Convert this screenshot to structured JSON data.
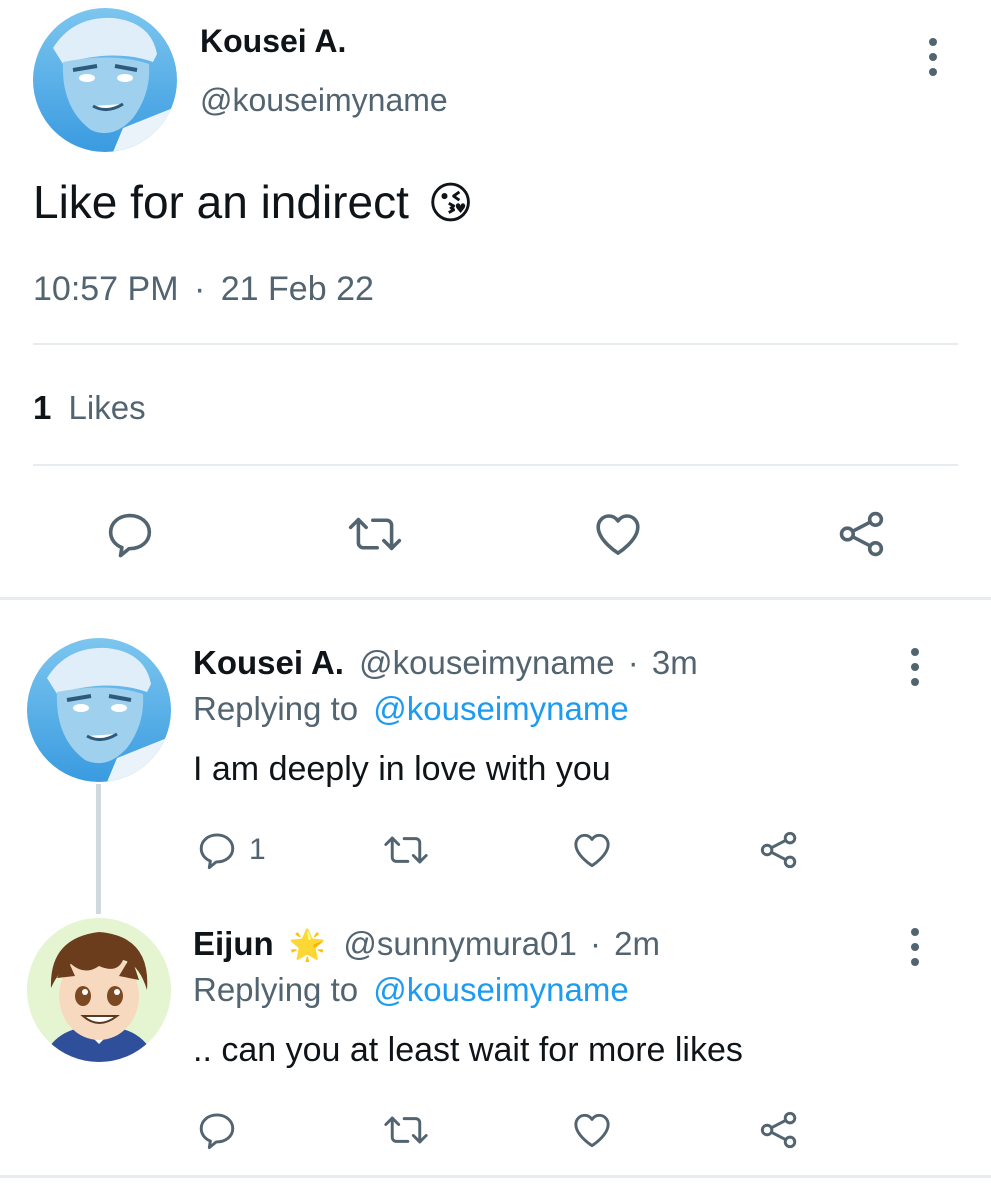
{
  "main_tweet": {
    "author_name": "Kousei A.",
    "author_handle": "@kouseimyname",
    "text": "Like for an indirect",
    "emoji": "😘",
    "time": "10:57 PM",
    "separator": "·",
    "date": "21 Feb 22",
    "likes_count": "1",
    "likes_label": "Likes",
    "avatar_icon": "avatar-kousei",
    "action_icons": [
      "reply-icon",
      "retweet-icon",
      "like-icon",
      "share-icon"
    ]
  },
  "replies": [
    {
      "author_name": "Kousei A.",
      "author_handle": "@kouseimyname",
      "separator": "·",
      "time_ago": "3m",
      "replying_prefix": "Replying to",
      "replying_handle": "@kouseimyname",
      "text": "I am deeply in love with you",
      "reply_count": "1",
      "avatar_icon": "avatar-kousei"
    },
    {
      "author_name": "Eijun",
      "name_emoji": "🌟",
      "author_handle": "@sunnymura01",
      "separator": "·",
      "time_ago": "2m",
      "replying_prefix": "Replying to",
      "replying_handle": "@kouseimyname",
      "text": ".. can you at least wait for more likes",
      "reply_count": "",
      "avatar_icon": "avatar-eijun"
    }
  ],
  "colors": {
    "text": "#0f1419",
    "muted": "#536471",
    "link": "#1d9bf0",
    "divider": "#e6ecf0"
  }
}
